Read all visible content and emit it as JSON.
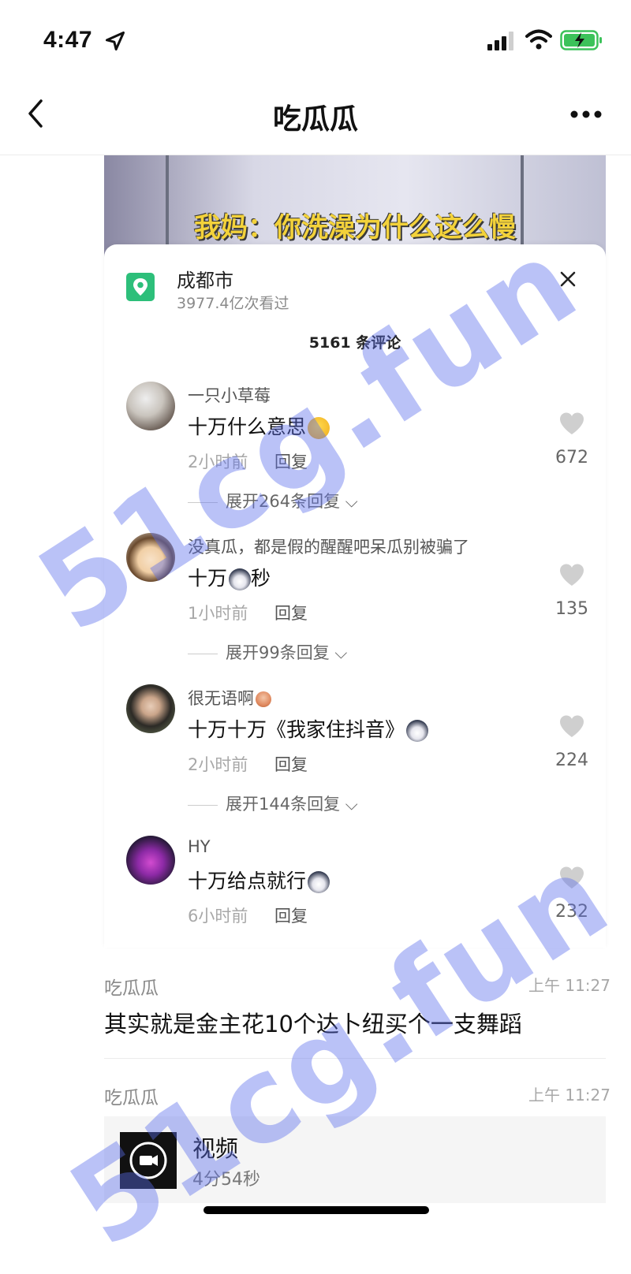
{
  "status_bar": {
    "time": "4:47"
  },
  "nav": {
    "title": "吃瓜瓜"
  },
  "video": {
    "caption": "我妈：你洗澡为什么这么慢"
  },
  "location": {
    "name": "成都市",
    "views": "3977.4亿次看过"
  },
  "comments_header": {
    "count_label": "5161 条评论"
  },
  "comments": [
    {
      "user": "一只小草莓",
      "text": "十万什么意思",
      "time": "2小时前",
      "reply": "回复",
      "likes": "672",
      "expand": "展开264条回复"
    },
    {
      "user": "没真瓜，都是假的醒醒吧呆瓜别被骗了",
      "text_before": "十万",
      "text_after": "秒",
      "time": "1小时前",
      "reply": "回复",
      "likes": "135",
      "expand": "展开99条回复"
    },
    {
      "user": "很无语啊",
      "text": "十万十万《我家住抖音》",
      "time": "2小时前",
      "reply": "回复",
      "likes": "224",
      "expand": "展开144条回复"
    },
    {
      "user": "HY",
      "text": "十万给点就行",
      "time": "6小时前",
      "reply": "回复",
      "likes": "232"
    }
  ],
  "messages": [
    {
      "sender": "吃瓜瓜",
      "time": "上午 11:27",
      "text": "其实就是金主花10个达卜纽买个一支舞蹈"
    },
    {
      "sender": "吃瓜瓜",
      "time": "上午 11:27",
      "video_title": "视频",
      "video_duration": "4分54秒"
    }
  ],
  "watermark": {
    "text": "51cg.fun"
  },
  "colors": {
    "location_icon": "#2dbf7a",
    "watermark": "#5a6eeb",
    "video_caption": "#f3d23a"
  }
}
